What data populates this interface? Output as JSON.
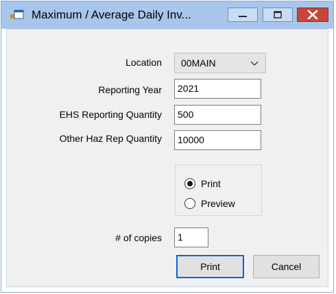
{
  "window": {
    "title": "Maximum / Average Daily Inv...",
    "title_color": "#a8c6ec",
    "close_color": "#c7463a"
  },
  "form": {
    "location_label": "Location",
    "location_value": "00MAIN",
    "year_label": "Reporting Year",
    "year_value": "2021",
    "ehs_label": "EHS Reporting Quantity",
    "ehs_value": "500",
    "other_label": "Other Haz Rep Quantity",
    "other_value": "10000",
    "radio_options": [
      {
        "label": "Print",
        "selected": true
      },
      {
        "label": "Preview",
        "selected": false
      }
    ],
    "copies_label": "# of copies",
    "copies_value": "1"
  },
  "buttons": {
    "print_label": "Print",
    "cancel_label": "Cancel"
  },
  "icons": {
    "app": "app-window-icon",
    "minimize": "minimize-icon",
    "maximize": "maximize-icon",
    "close": "close-icon",
    "dropdown": "chevron-down-icon"
  }
}
